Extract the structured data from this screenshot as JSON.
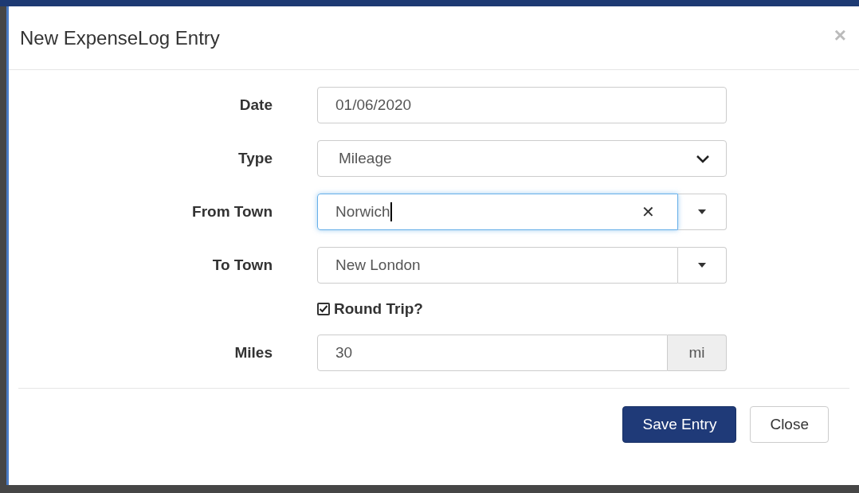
{
  "dialog": {
    "title": "New ExpenseLog Entry",
    "close_glyph": "×"
  },
  "fields": [
    {
      "kind": "text",
      "label": "Date",
      "value": "01/06/2020"
    },
    {
      "kind": "select",
      "label": "Type",
      "value": "Mileage"
    },
    {
      "kind": "combo",
      "label": "From Town",
      "value": "Norwich",
      "focused": true,
      "clear_glyph": "✕"
    },
    {
      "kind": "combo",
      "label": "To Town",
      "value": "New London",
      "focused": false
    },
    {
      "kind": "checkbox",
      "label": "Round Trip?",
      "checked": true
    },
    {
      "kind": "addon",
      "label": "Miles",
      "value": "30",
      "addon": "mi"
    }
  ],
  "buttons": [
    {
      "label": "Save Entry",
      "primary": true
    },
    {
      "label": "Close",
      "primary": false
    }
  ]
}
